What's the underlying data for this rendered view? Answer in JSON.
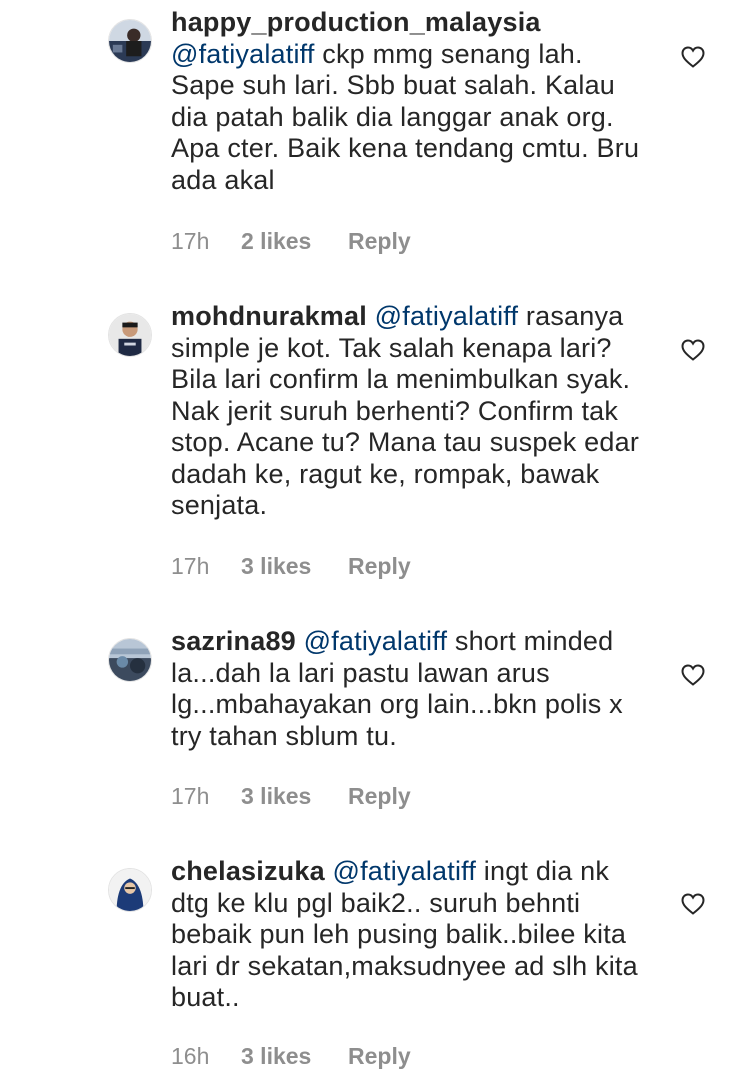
{
  "comments": [
    {
      "username": "happy_production_malaysia",
      "mention": "@fatiyalatiff",
      "text": " ckp mmg senang lah. Sape suh lari. Sbb buat salah. Kalau dia patah balik dia langgar anak org. Apa cter. Baik kena tendang cmtu. Bru ada akal",
      "time": "17h",
      "likes": "2 likes",
      "reply": "Reply",
      "avatar_color": "#2b3a55"
    },
    {
      "username": "mohdnurakmal",
      "mention": "@fatiyalatiff",
      "text": " rasanya simple je kot. Tak salah kenapa lari? Bila lari confirm la menimbulkan syak. Nak jerit suruh berhenti? Confirm tak stop. Acane tu? Mana tau suspek edar dadah ke, ragut ke, rompak, bawak senjata.",
      "time": "17h",
      "likes": "3 likes",
      "reply": "Reply",
      "avatar_color": "#1f2a44"
    },
    {
      "username": "sazrina89",
      "mention": "@fatiyalatiff",
      "text": " short minded la...dah la lari pastu lawan arus lg...mbahayakan org lain...bkn polis x try tahan sblum tu.",
      "time": "17h",
      "likes": "3 likes",
      "reply": "Reply",
      "avatar_color": "#3c4a5e"
    },
    {
      "username": "chelasizuka",
      "mention": "@fatiyalatiff",
      "text": " ingt dia nk dtg ke klu pgl baik2.. suruh behnti bebaik pun leh pusing balik..bilee kita lari dr sekatan,maksudnyee ad slh kita buat..",
      "time": "16h",
      "likes": "3 likes",
      "reply": "Reply",
      "avatar_color": "#1c3b78"
    }
  ],
  "icons": {
    "like": "heart-outline-icon"
  },
  "colors": {
    "text": "#262626",
    "meta": "#8e8e8e",
    "mention": "#00376b"
  }
}
